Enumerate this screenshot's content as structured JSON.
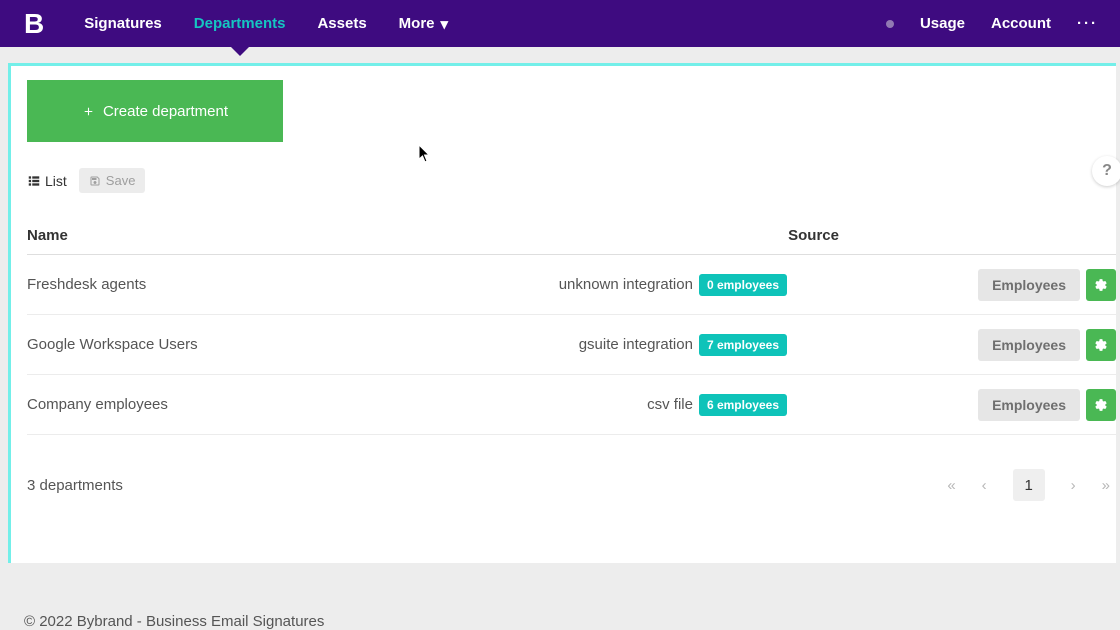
{
  "nav": {
    "logo": "B",
    "items": [
      "Signatures",
      "Departments",
      "Assets",
      "More"
    ],
    "active_index": 1,
    "right": {
      "usage": "Usage",
      "account": "Account"
    }
  },
  "actions": {
    "create_label": "Create department",
    "list_label": "List",
    "save_label": "Save",
    "help_label": "?"
  },
  "table": {
    "headers": {
      "name": "Name",
      "source": "Source"
    },
    "rows": [
      {
        "name": "Freshdesk agents",
        "source": "unknown integration",
        "badge": "0 employees",
        "action": "Employees"
      },
      {
        "name": "Google Workspace Users",
        "source": "gsuite integration",
        "badge": "7 employees",
        "action": "Employees"
      },
      {
        "name": "Company employees",
        "source": "csv file",
        "badge": "6 employees",
        "action": "Employees"
      }
    ],
    "footer_count": "3 departments",
    "pagination": {
      "current": "1"
    }
  },
  "footer": {
    "copyright": "© 2022 Bybrand - Business Email Signatures"
  }
}
